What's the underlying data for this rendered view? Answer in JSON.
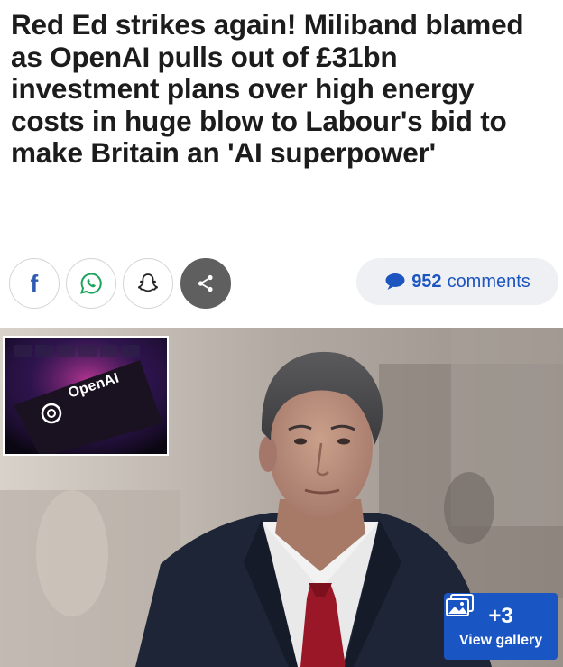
{
  "article": {
    "headline": "Red Ed strikes again! Miliband blamed as OpenAI pulls out of £31bn investment plans over high energy costs in huge blow to Labour's bid to make Britain an 'AI superpower'"
  },
  "share": {
    "facebook_letter": "f",
    "buttons": [
      "facebook-icon",
      "whatsapp-icon",
      "snapchat-icon",
      "share-icon"
    ]
  },
  "comments": {
    "count": "952",
    "label": "comments",
    "icon": "speech-bubble-icon",
    "color": "#1d55c0"
  },
  "hero": {
    "inset_logo_text": "OpenAI"
  },
  "gallery": {
    "count": "+3",
    "label": "View gallery",
    "icon": "gallery-icon",
    "color": "#1a55c4"
  }
}
